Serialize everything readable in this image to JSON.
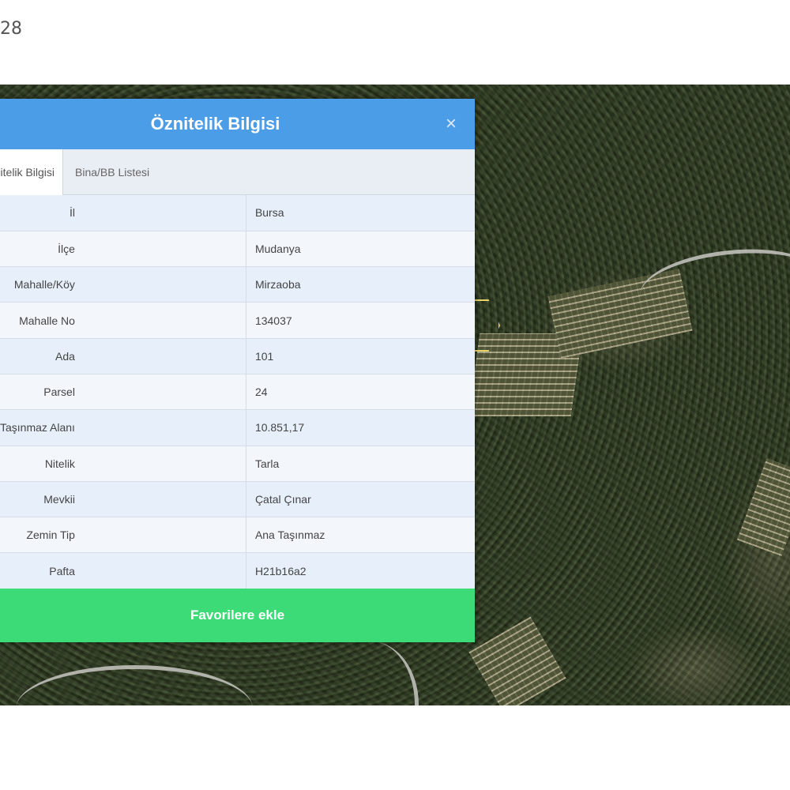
{
  "page_label": "28",
  "dialog": {
    "title": "Öznitelik Bilgisi",
    "close_glyph": "×",
    "tabs": [
      {
        "label": "Öznitelik Bilgisi",
        "active": true
      },
      {
        "label": "Bina/BB Listesi",
        "active": false
      }
    ],
    "rows": [
      {
        "label": "İl",
        "value": "Bursa"
      },
      {
        "label": "İlçe",
        "value": "Mudanya"
      },
      {
        "label": "Mahalle/Köy",
        "value": "Mirzaoba"
      },
      {
        "label": "Mahalle No",
        "value": "134037"
      },
      {
        "label": "Ada",
        "value": "101"
      },
      {
        "label": "Parsel",
        "value": "24"
      },
      {
        "label": "Taşınmaz Alanı",
        "value": "10.851,17"
      },
      {
        "label": "Nitelik",
        "value": "Tarla"
      },
      {
        "label": "Mevkii",
        "value": "Çatal Çınar"
      },
      {
        "label": "Zemin Tip",
        "value": "Ana Taşınmaz"
      },
      {
        "label": "Pafta",
        "value": "H21b16a2"
      }
    ],
    "favorite_button_label": "Favorilere ekle"
  }
}
